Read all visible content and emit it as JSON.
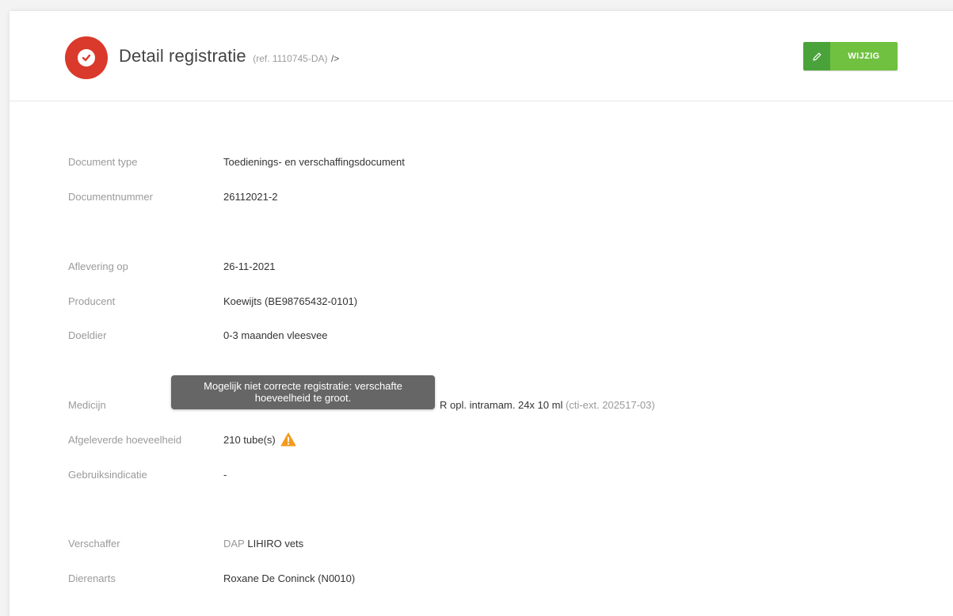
{
  "header": {
    "title": "Detail registratie",
    "ref": "(ref. 1110745-DA)",
    "ref_suffix": "/>",
    "edit_label": "WIJZIG"
  },
  "fields": {
    "document_type": {
      "label": "Document type",
      "value": "Toedienings- en verschaffingsdocument"
    },
    "documentnummer": {
      "label": "Documentnummer",
      "value": "26112021-2"
    },
    "aflevering_op": {
      "label": "Aflevering op",
      "value": "26-11-2021"
    },
    "producent": {
      "label": "Producent",
      "value": "Koewijts (BE98765432-0101)"
    },
    "doeldier": {
      "label": "Doeldier",
      "value": "0-3 maanden vleesvee"
    },
    "medicijn": {
      "label": "Medicijn",
      "value_visible": "R opl. intramam. 24x 10 ml",
      "value_code": "(cti-ext. 202517-03)"
    },
    "afgeleverde_hoeveelheid": {
      "label": "Afgeleverde hoeveelheid",
      "value": "210 tube(s)"
    },
    "gebruiksindicatie": {
      "label": "Gebruiksindicatie",
      "value": "-"
    },
    "verschaffer": {
      "label": "Verschaffer",
      "value_prefix": "DAP",
      "value_name": "LIHIRO vets"
    },
    "dierenarts": {
      "label": "Dierenarts",
      "value": "Roxane De Coninck (N0010)"
    }
  },
  "tooltip": {
    "line1": "Mogelijk niet correcte registratie: verschafte",
    "line2": "hoeveelheid te groot."
  },
  "icons": {
    "status": "check-circle-icon",
    "edit": "pencil-icon",
    "warning": "warning-triangle-icon"
  },
  "colors": {
    "status_red": "#d93a2b",
    "button_green": "#6fc13f",
    "button_green_dark": "#4aa33a",
    "warning_orange": "#f39a1e",
    "tooltip_bg": "#666666"
  }
}
